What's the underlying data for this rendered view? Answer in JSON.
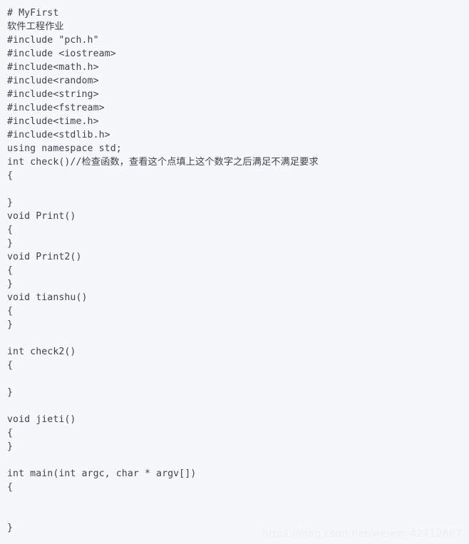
{
  "page": {
    "background_color": "#f6f7f9",
    "text_color": "#3d4450",
    "watermark_color": "#eceef1"
  },
  "code": {
    "language": "cpp",
    "lines": [
      "# MyFirst",
      "软件工程作业",
      "#include \"pch.h\"",
      "#include <iostream>",
      "#include<math.h>",
      "#include<random>",
      "#include<string>",
      "#include<fstream>",
      "#include<time.h>",
      "#include<stdlib.h>",
      "using namespace std;",
      "int check()//检查函数，查看这个点填上这个数字之后满足不满足要求",
      "{",
      "",
      "}",
      "void Print()",
      "{",
      "}",
      "void Print2()",
      "{",
      "}",
      "void tianshu()",
      "{",
      "}",
      "",
      "int check2()",
      "{",
      "",
      "}",
      "",
      "void jieti()",
      "{",
      "}",
      "",
      "int main(int argc, char * argv[])",
      "{",
      "",
      "",
      "}"
    ]
  },
  "watermark": {
    "text": "https://blog.csdn.net/weixin_42412667"
  }
}
